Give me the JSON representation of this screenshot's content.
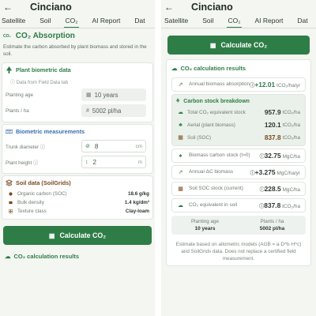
{
  "app": {
    "title": "Cinciano",
    "back_icon": "back-arrow-icon"
  },
  "left": {
    "tabs": [
      "Satellite",
      "Soil",
      "CO₂",
      "AI Report",
      "Dat"
    ],
    "active_tab": 2,
    "section": {
      "tag": "CO₂",
      "title": "CO₂ Absorption",
      "description": "Estimate the carbon absorbed by plant biomass and stored in the soil."
    },
    "plant": {
      "title": "Plant biometric data",
      "source_note": "Data from Field Data tab",
      "planting_age_label": "Planting age",
      "planting_age_value": "10 years",
      "plants_label": "Plants / ha",
      "plants_prefix": "#",
      "plants_value": "5002 pl/ha"
    },
    "biometric": {
      "title": "Biometric measurements",
      "trunk_label": "Trunk diameter",
      "trunk_value": "8",
      "trunk_unit": "cm",
      "height_label": "Plant height",
      "height_value": "2",
      "height_unit": "m"
    },
    "soil": {
      "title": "Soil data (SoilGrids)",
      "rows": [
        {
          "label": "Organic carbon (SOC)",
          "value": "18.6 g/kg"
        },
        {
          "label": "Bulk density",
          "value": "1.4 kg/dm³"
        },
        {
          "label": "Texture class",
          "value": "Clay-loam"
        }
      ]
    },
    "button_label": "Calculate CO₂",
    "results_title": "CO₂ calculation results"
  },
  "right": {
    "tabs": [
      "Satellite",
      "Soil",
      "CO₂",
      "AI Report",
      "Dat"
    ],
    "active_tab": 2,
    "button_label": "Calculate CO₂",
    "results_title": "CO₂ calculation results",
    "annual": {
      "label": "Annual biomass absorption",
      "value": "+12.01",
      "unit": "tCO₂/ha/yr"
    },
    "breakdown": {
      "title": "Carbon stock breakdown",
      "rows": [
        {
          "label": "Total CO₂ equivalent stock",
          "value": "957.9",
          "unit": "tCO₂/ha"
        },
        {
          "label": "Aerial (plant biomass)",
          "value": "120.1",
          "unit": "tCO₂/ha"
        },
        {
          "label": "Soil (SOC)",
          "value": "837.8",
          "unit": "tCO₂/ha"
        }
      ]
    },
    "items": [
      {
        "label": "Biomass carbon stock (t=0)",
        "value": "32.75",
        "unit": "MgC/ha"
      },
      {
        "label": "Annual ΔC biomass",
        "value": "+3.275",
        "unit": "MgC/ha/yr"
      },
      {
        "label": "Soil SOC stock (current)",
        "value": "228.5",
        "unit": "MgC/ha"
      },
      {
        "label": "CO₂ equivalent in soil",
        "value": "837.8",
        "unit": "tCO₂/ha"
      }
    ],
    "summary": {
      "age_label": "Planting age",
      "age_value": "10 years",
      "plants_label": "Plants / ha",
      "plants_value": "5002 pl/ha"
    },
    "footnote": "Estimate based on allometric models (AGB = a·D^b·H^c) and SoilGrids data. Does not replace a certified field measurement."
  },
  "colors": {
    "accent": "#2e7d46",
    "soil": "#7a4a1e",
    "background": "#f4f6f2"
  }
}
